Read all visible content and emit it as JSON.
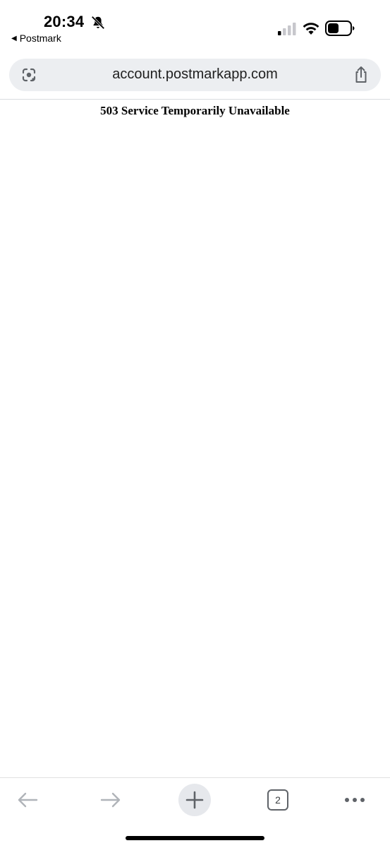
{
  "status_bar": {
    "time": "20:34",
    "back_app_label": "Postmark",
    "icons": [
      "bell-slash-icon",
      "signal-icon",
      "wifi-icon",
      "battery-icon"
    ],
    "battery_level": 0.5,
    "signal_bars_active": 1
  },
  "browser": {
    "url": "account.postmarkapp.com",
    "lens_icon": "google-lens-icon",
    "share_icon": "share-icon"
  },
  "page": {
    "heading": "503 Service Temporarily Unavailable"
  },
  "toolbar": {
    "back_icon": "arrow-left-icon",
    "forward_icon": "arrow-right-icon",
    "new_tab_icon": "plus-icon",
    "tab_count": "2",
    "more_icon": "more-horizontal-icon"
  },
  "colors": {
    "urlbar_bg": "#eceef1",
    "icon_gray": "#5f6368",
    "disabled_icon": "#b0b4b9"
  }
}
